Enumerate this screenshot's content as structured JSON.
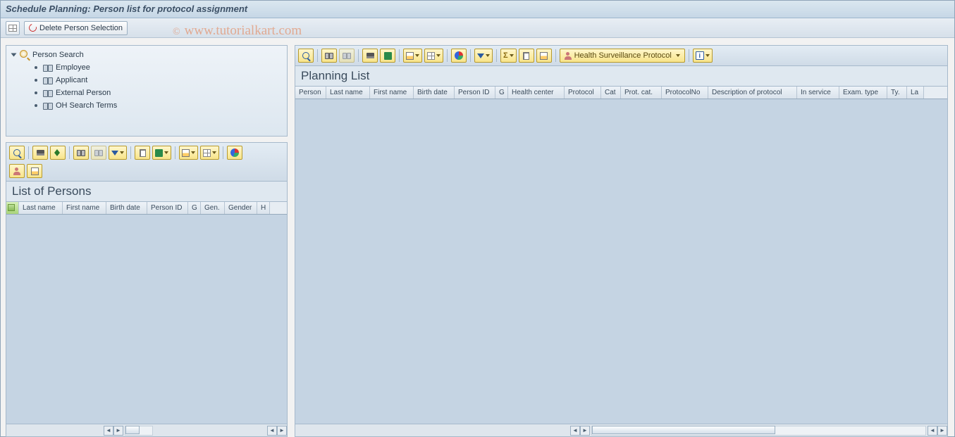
{
  "title": "Schedule Planning: Person list for protocol assignment",
  "app_toolbar": {
    "delete_label": "Delete Person Selection"
  },
  "watermark": "www.tutorialkart.com",
  "tree": {
    "root": "Person Search",
    "items": [
      "Employee",
      "Applicant",
      "External Person",
      "OH Search Terms"
    ]
  },
  "left_list": {
    "title": "List of Persons",
    "columns": [
      "Last name",
      "First name",
      "Birth date",
      "Person ID",
      "G",
      "Gen.",
      "Gender",
      "H"
    ]
  },
  "right_list": {
    "title": "Planning List",
    "protocol_button": "Health Surveillance Protocol",
    "columns": [
      "Person",
      "Last name",
      "First name",
      "Birth date",
      "Person ID",
      "G",
      "Health center",
      "Protocol",
      "Cat",
      "Prot. cat.",
      "ProtocolNo",
      "Description of protocol",
      "In service",
      "Exam. type",
      "Ty.",
      "La"
    ]
  }
}
